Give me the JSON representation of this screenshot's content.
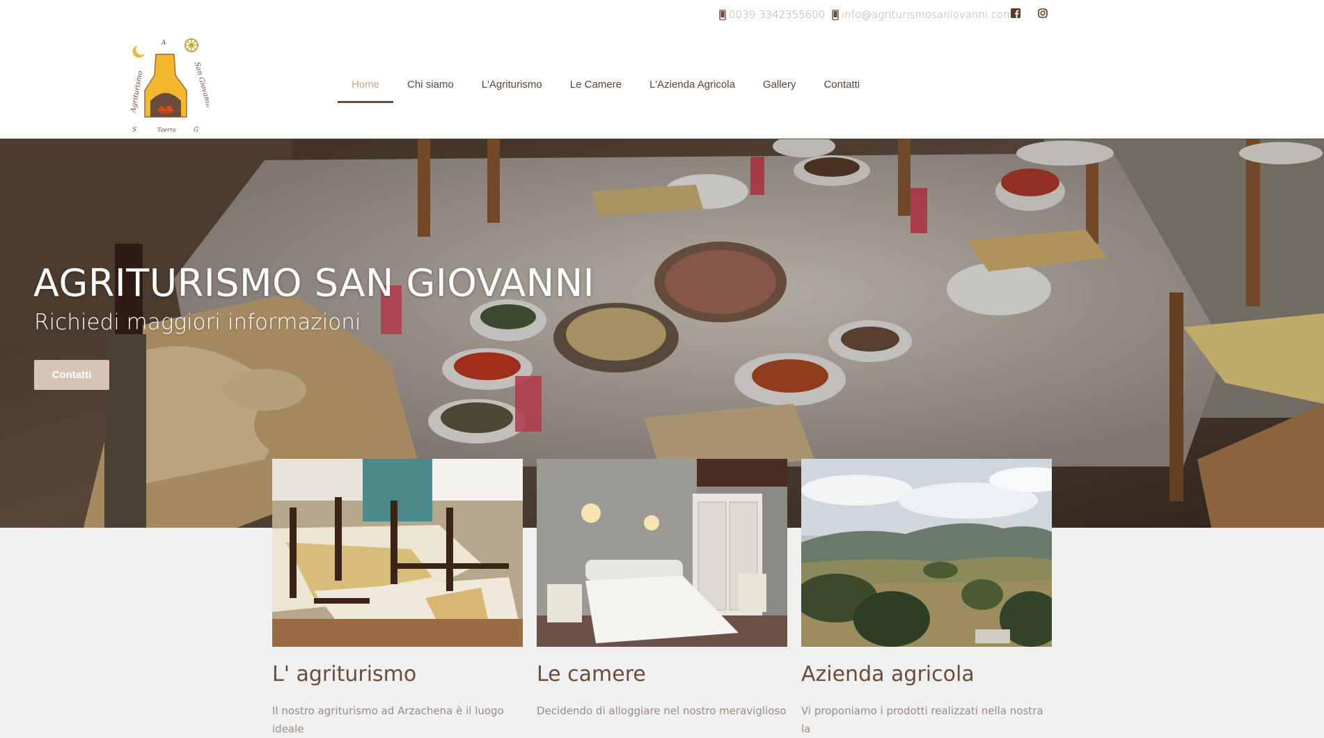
{
  "topbar": {
    "phone": "0039 3342355600",
    "email": "info@agriturismosaniovanni.com",
    "facebook_icon": "facebook-icon",
    "instagram_icon": "instagram-icon",
    "accent": "#c8a68c"
  },
  "logo": {
    "top_text": "A",
    "left_text": "Agriturismo",
    "right_text": "San Giovanni",
    "bottom_left": "S",
    "bottom_center": "Taerra",
    "bottom_right": "G"
  },
  "nav": {
    "items": [
      {
        "label": "Home",
        "active": true
      },
      {
        "label": "Chi siamo"
      },
      {
        "label": "L'Agriturismo"
      },
      {
        "label": "Le Camere"
      },
      {
        "label": "L'Azienda Agricola"
      },
      {
        "label": "Gallery"
      },
      {
        "label": "Contatti"
      }
    ]
  },
  "hero": {
    "title": "AGRITURISMO SAN GIOVANNI",
    "subtitle": "Richiedi maggiori informazioni",
    "button": "Contatti"
  },
  "cards": [
    {
      "title": "L' agriturismo",
      "text": "Il nostro agriturismo ad Arzachena è il luogo ideale"
    },
    {
      "title": "Le camere",
      "text": "Decidendo di alloggiare nel nostro meraviglioso"
    },
    {
      "title": "Azienda agricola",
      "text": "Vi proponiamo i prodotti realizzati nella nostra la"
    }
  ],
  "colors": {
    "brown": "#6b4c3b",
    "button": "#d8c4b6"
  }
}
